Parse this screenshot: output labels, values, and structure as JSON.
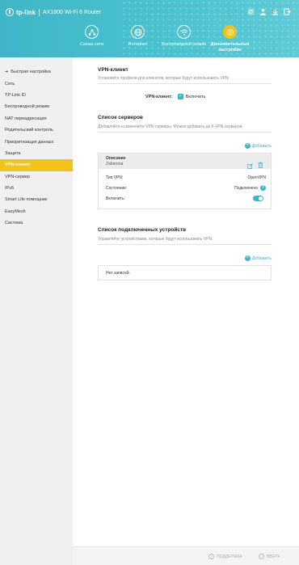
{
  "header": {
    "brand": "tp-link",
    "model": "AX1800 Wi-Fi 6 Router",
    "top_icons": [
      "settings-icon",
      "user-icon",
      "download-icon",
      "logout-icon"
    ],
    "nav": [
      {
        "label": "Схема сети",
        "icon": "network-map-icon"
      },
      {
        "label": "Интернет",
        "icon": "globe-icon"
      },
      {
        "label": "Беспроводной режим",
        "icon": "wifi-icon"
      },
      {
        "label": "Дополнительные настройки",
        "icon": "gear-icon",
        "active": true
      }
    ]
  },
  "sidebar": {
    "items": [
      {
        "label": "Быстрая настройка",
        "arrow": true
      },
      {
        "label": "Сеть"
      },
      {
        "label": "TP-Link ID"
      },
      {
        "label": "Беспроводной режим"
      },
      {
        "label": "NAT переадресация"
      },
      {
        "label": "Родительский контроль"
      },
      {
        "label": "Приоритизация данных"
      },
      {
        "label": "Защита"
      },
      {
        "label": "VPN-клиент",
        "active": true
      },
      {
        "label": "VPN-сервер"
      },
      {
        "label": "IPv6"
      },
      {
        "label": "Smart Life помощник"
      },
      {
        "label": "EasyMesh"
      },
      {
        "label": "Система"
      }
    ]
  },
  "vpn_client": {
    "title": "VPN-клиент",
    "subtitle": "Установите профили для клиентов, которые будут использовать VPN.",
    "checkbox_label": "VPN-клиент:",
    "checkbox_text": "Включить",
    "checkbox_checked": true
  },
  "servers": {
    "title": "Список серверов",
    "subtitle": "Добавляйте и изменяйте VPN серверы. Можно добавить до 6 VPN серверов.",
    "add_label": "Добавить",
    "card": {
      "desc_label": "Описание",
      "desc_value": "Zaborona",
      "type_label": "Тип VPN:",
      "type_value": "OpenVPN",
      "state_label": "Состояние:",
      "state_value": "Подключено",
      "enable_label": "Включить:",
      "enabled": true
    }
  },
  "devices": {
    "title": "Список подключенных устройств",
    "subtitle": "Управляйте устройствами, которые будут использовать VPN.",
    "add_label": "Добавить",
    "empty_text": "Нет записей."
  },
  "footer": {
    "support": "ПОДДЕРЖКА",
    "top": "ВВЕРХ"
  },
  "colors": {
    "accent": "#3fb6c7",
    "active": "#f3c21b"
  }
}
